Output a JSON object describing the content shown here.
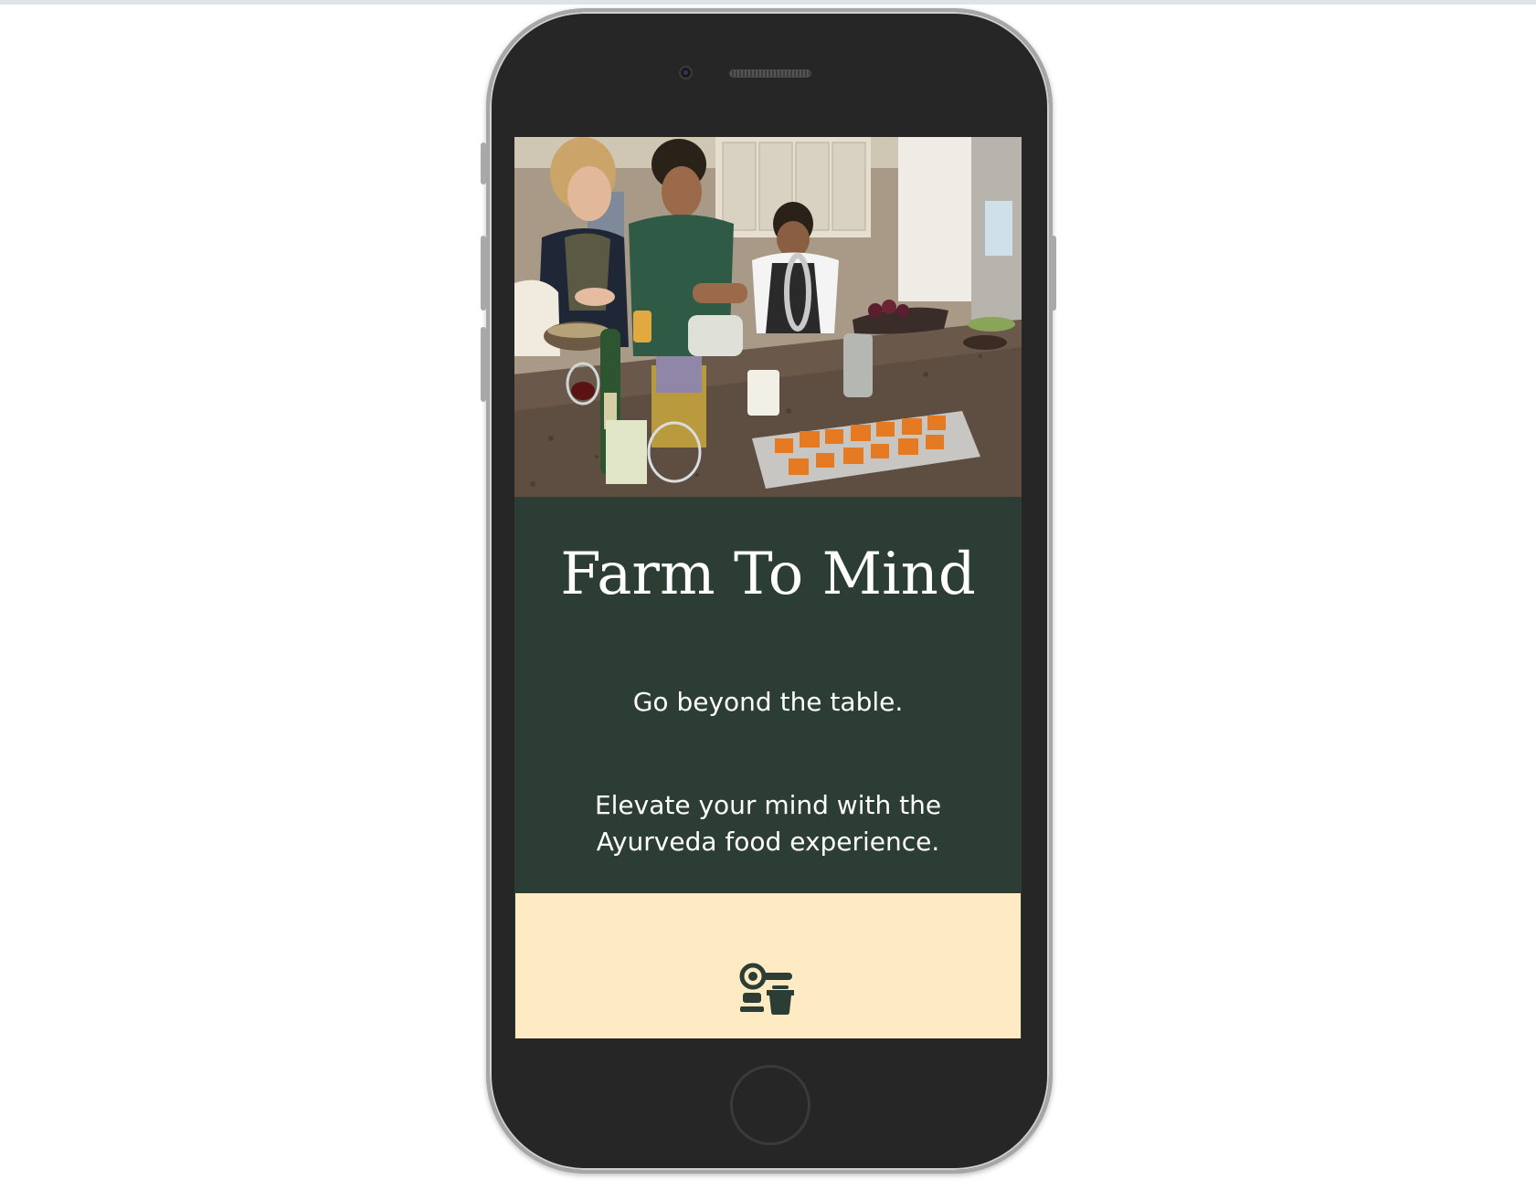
{
  "hero": {
    "image_alt": "people cooking together in a kitchen"
  },
  "intro": {
    "title": "Farm To Mind",
    "subtitle": "Go beyond the table.",
    "tagline": "Elevate your mind with the Ayurveda food experience."
  },
  "feature": {
    "icon": "kitchen-tools-icon"
  },
  "colors": {
    "intro_bg": "#2b3d34",
    "cream_bg": "#feebc3",
    "phone_body": "#262626"
  }
}
